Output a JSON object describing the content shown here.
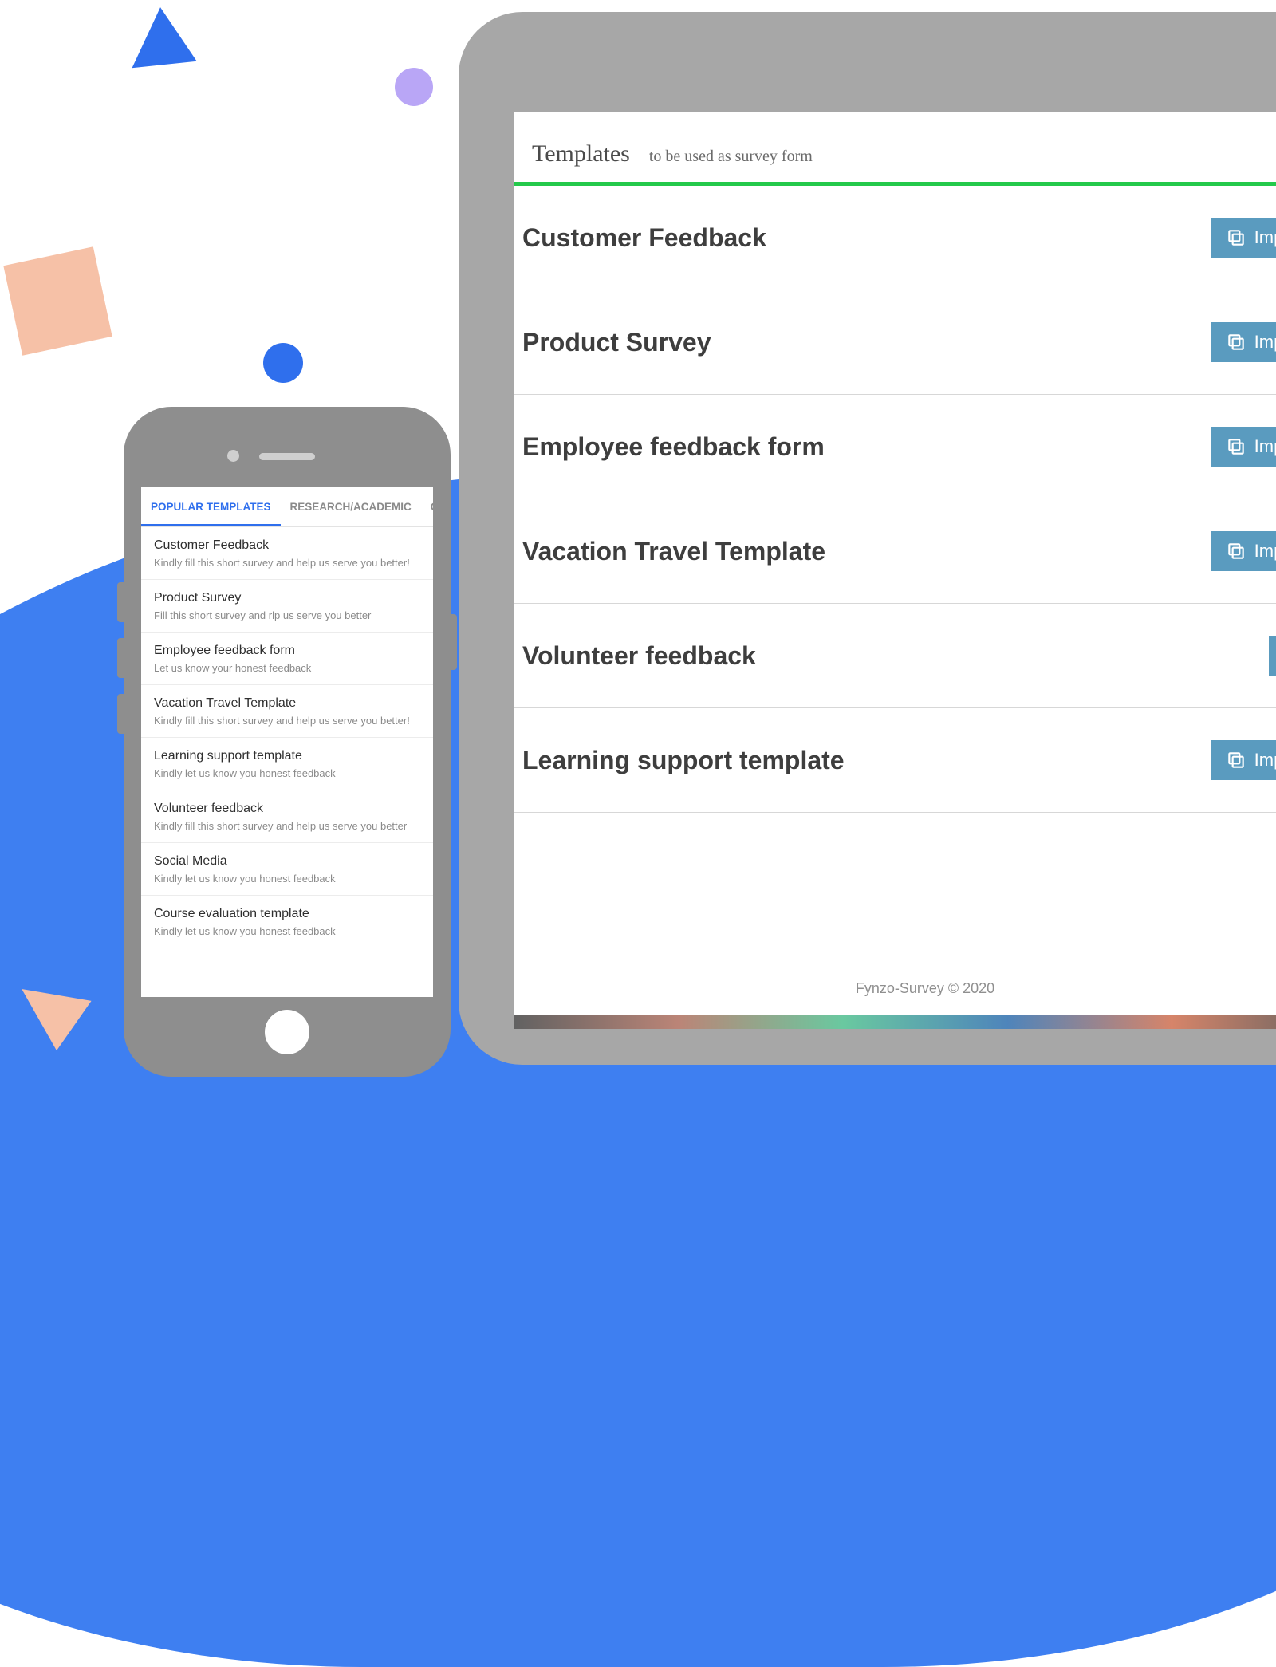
{
  "tablet": {
    "header_title": "Templates",
    "header_subtitle": "to be used as survey form",
    "import_label": "Import",
    "rows": [
      {
        "title": "Customer Feedback",
        "import": true
      },
      {
        "title": "Product Survey",
        "import": true
      },
      {
        "title": "Employee feedback form",
        "import": true
      },
      {
        "title": "Vacation Travel Template",
        "import": true
      },
      {
        "title": "Volunteer feedback",
        "import": false
      },
      {
        "title": "Learning support template",
        "import": true
      }
    ],
    "footer": "Fynzo-Survey © 2020"
  },
  "phone": {
    "tabs": [
      {
        "label": "POPULAR TEMPLATES",
        "active": true
      },
      {
        "label": "RESEARCH/ACADEMIC",
        "active": false
      },
      {
        "label": "CUST",
        "active": false
      }
    ],
    "items": [
      {
        "title": "Customer Feedback",
        "desc": "Kindly fill this short survey and help us serve you better!"
      },
      {
        "title": "Product Survey",
        "desc": "Fill this short survey and rlp us serve you better"
      },
      {
        "title": "Employee feedback form",
        "desc": "Let us know your honest feedback"
      },
      {
        "title": "Vacation Travel Template",
        "desc": "Kindly fill this short survey and help us serve you better!"
      },
      {
        "title": "Learning support template",
        "desc": "Kindly let us know you honest feedback"
      },
      {
        "title": "Volunteer feedback",
        "desc": "Kindly fill this short survey and help us serve you better"
      },
      {
        "title": "Social Media",
        "desc": "Kindly let us know you honest feedback"
      },
      {
        "title": "Course evaluation template",
        "desc": "Kindly let us know you honest feedback"
      }
    ]
  }
}
